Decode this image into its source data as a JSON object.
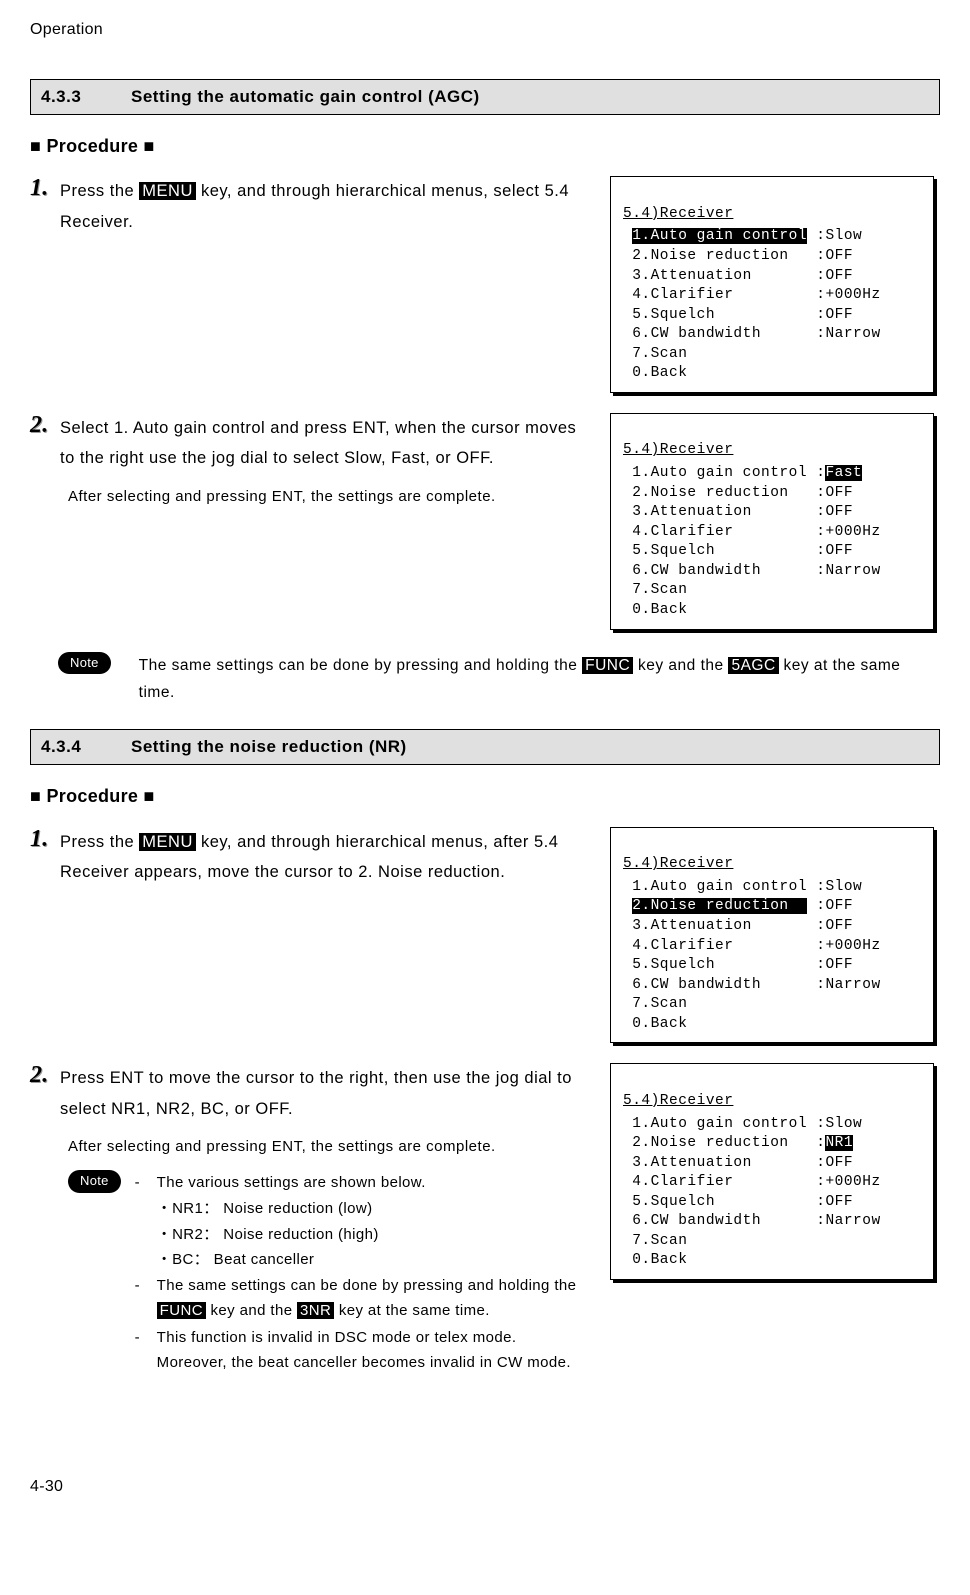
{
  "header": "Operation",
  "footer": "4-30",
  "sections": {
    "agc": {
      "number": "4.3.3",
      "title": "Setting the automatic gain control (AGC)",
      "procedure_label": "■ Procedure ■",
      "steps": [
        {
          "num": "1.",
          "pre": "Press the ",
          "key": "MENU",
          "post": " key, and through hierarchical menus, select 5.4 Receiver."
        },
        {
          "num": "2.",
          "text": "Select 1. Auto gain control and press ENT, when the cursor moves to the right use the jog dial to select Slow, Fast, or OFF.",
          "after": "After selecting and pressing ENT, the settings are complete."
        }
      ],
      "note": {
        "label": "Note",
        "pre": "The same settings can be done by pressing and holding the ",
        "key1": "FUNC",
        "mid": " key and the ",
        "key2": "5AGC",
        "post": " key at the same time."
      }
    },
    "nr": {
      "number": "4.3.4",
      "title": "Setting the noise reduction (NR)",
      "procedure_label": "■ Procedure ■",
      "steps": [
        {
          "num": "1.",
          "pre": "Press the ",
          "key": "MENU",
          "post": " key, and through hierarchical menus, after 5.4 Receiver appears, move the cursor to 2. Noise reduction."
        },
        {
          "num": "2.",
          "text": "Press ENT to move the cursor to the right, then use the jog dial to select NR1, NR2, BC, or OFF.",
          "after": "After selecting and pressing ENT, the settings are complete."
        }
      ],
      "note": {
        "label": "Note",
        "items": [
          {
            "text": "The various settings are shown below."
          },
          {
            "sub": "・NR1：   Noise reduction (low)"
          },
          {
            "sub": "・NR2：   Noise reduction (high)"
          },
          {
            "sub": "・BC：    Beat canceller"
          },
          {
            "pre": "The same settings can be done by pressing and holding the ",
            "key1": "FUNC",
            "mid": " key and the ",
            "key2": "3NR",
            "post": " key at the same time."
          },
          {
            "text": "This function is invalid in DSC mode or telex mode. Moreover, the beat canceller becomes invalid in CW mode."
          }
        ]
      }
    }
  },
  "menus": {
    "title": "5.4)Receiver",
    "labels": {
      "l1": "1.Auto gain control",
      "l2": "2.Noise reduction",
      "l3": "3.Attenuation",
      "l4": "4.Clarifier",
      "l5": "5.Squelch",
      "l6": "6.CW bandwidth",
      "l7": "7.Scan",
      "l0": "0.Back"
    },
    "values": {
      "slow": "Slow",
      "fast": "Fast",
      "off": "OFF",
      "hz": "+000Hz",
      "narrow": "Narrow",
      "nr1": "NR1"
    }
  }
}
